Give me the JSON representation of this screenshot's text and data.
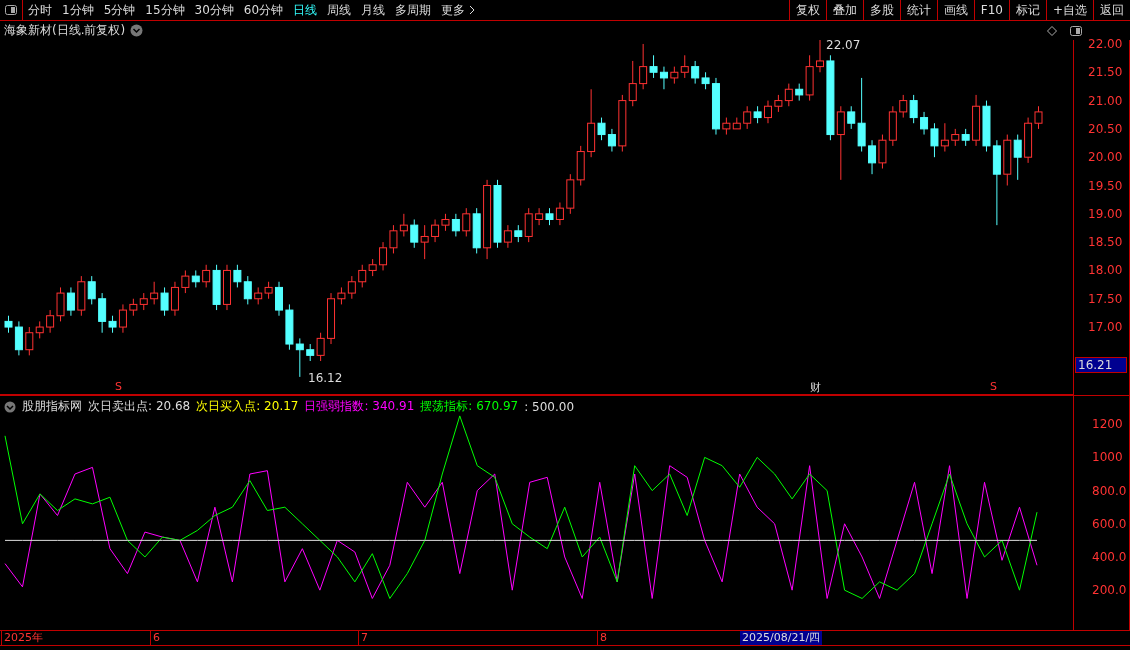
{
  "toolbar": {
    "periods": [
      {
        "label": "分时",
        "selected": false
      },
      {
        "label": "1分钟",
        "selected": false
      },
      {
        "label": "5分钟",
        "selected": false
      },
      {
        "label": "15分钟",
        "selected": false
      },
      {
        "label": "30分钟",
        "selected": false
      },
      {
        "label": "60分钟",
        "selected": false
      },
      {
        "label": "日线",
        "selected": true
      },
      {
        "label": "周线",
        "selected": false
      },
      {
        "label": "月线",
        "selected": false
      },
      {
        "label": "多周期",
        "selected": false
      }
    ],
    "more": "更多",
    "actions": [
      "复权",
      "叠加",
      "多股",
      "统计",
      "画线",
      "F10",
      "标记",
      "+自选",
      "返回"
    ]
  },
  "title": "海象新材(日线.前复权)",
  "price_chart": {
    "high_label": "22.07",
    "low_label": "16.12",
    "current_price": "16.21",
    "markers": [
      {
        "kind": "signal",
        "label": "S"
      },
      {
        "kind": "finance",
        "label": "财"
      },
      {
        "kind": "signal",
        "label": "S"
      }
    ],
    "chart_data": {
      "type": "candlestick",
      "ylim": [
        15.8,
        22.07
      ],
      "yticks": [
        {
          "value": 22,
          "label": "22.00"
        },
        {
          "value": 21.5,
          "label": "21.50"
        },
        {
          "value": 21,
          "label": "21.00"
        },
        {
          "value": 20.5,
          "label": "20.50"
        },
        {
          "value": 20,
          "label": "20.00"
        },
        {
          "value": 19.5,
          "label": "19.50"
        },
        {
          "value": 19,
          "label": "19.00"
        },
        {
          "value": 18.5,
          "label": "18.50"
        },
        {
          "value": 18,
          "label": "18.00"
        },
        {
          "value": 17.5,
          "label": "17.50"
        },
        {
          "value": 17,
          "label": "17.00"
        }
      ],
      "ohlc": [
        [
          17.1,
          17.2,
          16.9,
          17.0
        ],
        [
          17.0,
          17.1,
          16.5,
          16.6
        ],
        [
          16.6,
          17.0,
          16.5,
          16.9
        ],
        [
          16.9,
          17.1,
          16.8,
          17.0
        ],
        [
          17.0,
          17.3,
          16.9,
          17.2
        ],
        [
          17.2,
          17.7,
          17.1,
          17.6
        ],
        [
          17.6,
          17.7,
          17.2,
          17.3
        ],
        [
          17.3,
          17.9,
          17.2,
          17.8
        ],
        [
          17.8,
          17.9,
          17.4,
          17.5
        ],
        [
          17.5,
          17.6,
          16.9,
          17.1
        ],
        [
          17.1,
          17.2,
          16.9,
          17.0
        ],
        [
          17.0,
          17.4,
          16.9,
          17.3
        ],
        [
          17.3,
          17.5,
          17.2,
          17.4
        ],
        [
          17.4,
          17.6,
          17.3,
          17.5
        ],
        [
          17.5,
          17.8,
          17.4,
          17.6
        ],
        [
          17.6,
          17.7,
          17.2,
          17.3
        ],
        [
          17.3,
          17.8,
          17.2,
          17.7
        ],
        [
          17.7,
          18.0,
          17.6,
          17.9
        ],
        [
          17.9,
          18.0,
          17.7,
          17.8
        ],
        [
          17.8,
          18.1,
          17.7,
          18.0
        ],
        [
          18.0,
          18.1,
          17.3,
          17.4
        ],
        [
          17.4,
          18.1,
          17.3,
          18.0
        ],
        [
          18.0,
          18.1,
          17.7,
          17.8
        ],
        [
          17.8,
          17.9,
          17.4,
          17.5
        ],
        [
          17.5,
          17.7,
          17.4,
          17.6
        ],
        [
          17.6,
          17.8,
          17.5,
          17.7
        ],
        [
          17.7,
          17.8,
          17.2,
          17.3
        ],
        [
          17.3,
          17.4,
          16.6,
          16.7
        ],
        [
          16.7,
          16.8,
          16.12,
          16.6
        ],
        [
          16.6,
          16.7,
          16.4,
          16.5
        ],
        [
          16.5,
          16.9,
          16.4,
          16.8
        ],
        [
          16.8,
          17.6,
          16.7,
          17.5
        ],
        [
          17.5,
          17.7,
          17.4,
          17.6
        ],
        [
          17.6,
          17.9,
          17.5,
          17.8
        ],
        [
          17.8,
          18.1,
          17.7,
          18.0
        ],
        [
          18.0,
          18.2,
          17.9,
          18.1
        ],
        [
          18.1,
          18.5,
          18.0,
          18.4
        ],
        [
          18.4,
          18.8,
          18.3,
          18.7
        ],
        [
          18.7,
          19.0,
          18.6,
          18.8
        ],
        [
          18.8,
          18.9,
          18.4,
          18.5
        ],
        [
          18.5,
          18.8,
          18.2,
          18.6
        ],
        [
          18.6,
          18.9,
          18.5,
          18.8
        ],
        [
          18.8,
          19.0,
          18.7,
          18.9
        ],
        [
          18.9,
          19.0,
          18.6,
          18.7
        ],
        [
          18.7,
          19.1,
          18.6,
          19.0
        ],
        [
          19.0,
          19.1,
          18.3,
          18.4
        ],
        [
          18.4,
          19.6,
          18.2,
          19.5
        ],
        [
          19.5,
          19.6,
          18.4,
          18.5
        ],
        [
          18.5,
          18.8,
          18.4,
          18.7
        ],
        [
          18.7,
          18.8,
          18.5,
          18.6
        ],
        [
          18.6,
          19.1,
          18.5,
          19.0
        ],
        [
          18.9,
          19.1,
          18.8,
          19.0
        ],
        [
          19.0,
          19.1,
          18.8,
          18.9
        ],
        [
          18.9,
          19.2,
          18.8,
          19.1
        ],
        [
          19.1,
          19.7,
          19.0,
          19.6
        ],
        [
          19.6,
          20.2,
          19.5,
          20.1
        ],
        [
          20.1,
          21.2,
          20.0,
          20.6
        ],
        [
          20.6,
          20.7,
          20.3,
          20.4
        ],
        [
          20.4,
          20.5,
          20.1,
          20.2
        ],
        [
          20.2,
          21.1,
          20.1,
          21.0
        ],
        [
          21.0,
          21.7,
          20.9,
          21.3
        ],
        [
          21.3,
          22.0,
          21.2,
          21.6
        ],
        [
          21.6,
          21.8,
          21.4,
          21.5
        ],
        [
          21.5,
          21.6,
          21.2,
          21.4
        ],
        [
          21.4,
          21.6,
          21.3,
          21.5
        ],
        [
          21.5,
          21.8,
          21.4,
          21.6
        ],
        [
          21.6,
          21.7,
          21.3,
          21.4
        ],
        [
          21.4,
          21.5,
          21.2,
          21.3
        ],
        [
          21.3,
          21.4,
          20.4,
          20.5
        ],
        [
          20.5,
          20.7,
          20.4,
          20.6
        ],
        [
          20.5,
          20.7,
          20.5,
          20.6
        ],
        [
          20.6,
          20.9,
          20.5,
          20.8
        ],
        [
          20.8,
          20.9,
          20.6,
          20.7
        ],
        [
          20.7,
          21.0,
          20.6,
          20.9
        ],
        [
          20.9,
          21.1,
          20.8,
          21.0
        ],
        [
          21.0,
          21.3,
          20.9,
          21.2
        ],
        [
          21.2,
          21.3,
          21.0,
          21.1
        ],
        [
          21.1,
          21.8,
          21.0,
          21.6
        ],
        [
          21.6,
          22.07,
          21.5,
          21.7
        ],
        [
          21.7,
          21.8,
          20.3,
          20.4
        ],
        [
          20.4,
          20.9,
          19.6,
          20.8
        ],
        [
          20.8,
          20.9,
          20.5,
          20.6
        ],
        [
          20.6,
          21.4,
          20.1,
          20.2
        ],
        [
          20.2,
          20.3,
          19.7,
          19.9
        ],
        [
          19.9,
          20.4,
          19.8,
          20.3
        ],
        [
          20.3,
          20.9,
          20.2,
          20.8
        ],
        [
          20.8,
          21.1,
          20.7,
          21.0
        ],
        [
          21.0,
          21.1,
          20.6,
          20.7
        ],
        [
          20.7,
          20.8,
          20.4,
          20.5
        ],
        [
          20.5,
          20.6,
          20.0,
          20.2
        ],
        [
          20.2,
          20.6,
          20.1,
          20.3
        ],
        [
          20.3,
          20.5,
          20.2,
          20.4
        ],
        [
          20.4,
          20.5,
          20.2,
          20.3
        ],
        [
          20.3,
          21.1,
          20.2,
          20.9
        ],
        [
          20.9,
          21.0,
          20.1,
          20.2
        ],
        [
          20.2,
          20.3,
          18.8,
          19.7
        ],
        [
          19.7,
          20.4,
          19.5,
          20.3
        ],
        [
          20.3,
          20.4,
          19.6,
          20.0
        ],
        [
          20.0,
          20.7,
          19.9,
          20.6
        ],
        [
          20.6,
          20.9,
          20.5,
          20.8
        ]
      ]
    }
  },
  "indicator": {
    "name": "股朋指标网",
    "legend": [
      {
        "label": "次日卖出点:",
        "value": "20.68",
        "color": "#dddddd"
      },
      {
        "label": "次日买入点:",
        "value": "20.17",
        "color": "#ffff00"
      },
      {
        "label": "日强弱指数:",
        "value": "340.91",
        "color": "#ff00ff"
      },
      {
        "label": "摆荡指标:",
        "value": "670.97",
        "color": "#00ff00"
      },
      {
        "label": ":",
        "value": "500.00",
        "color": "#dddddd"
      }
    ],
    "chart_data": {
      "type": "line",
      "ylim": [
        -40,
        1370
      ],
      "yticks": [
        {
          "value": 1200,
          "label": "1200"
        },
        {
          "value": 1000,
          "label": "1000"
        },
        {
          "value": 800,
          "label": "800.0"
        },
        {
          "value": 600,
          "label": "600.0"
        },
        {
          "value": 400,
          "label": "400.0"
        },
        {
          "value": 200,
          "label": "200.0"
        }
      ],
      "series": [
        {
          "color": "#ff00ff",
          "values": [
            360,
            220,
            780,
            650,
            900,
            940,
            450,
            300,
            550,
            520,
            500,
            250,
            700,
            250,
            900,
            920,
            250,
            450,
            200,
            500,
            430,
            150,
            350,
            850,
            700,
            850,
            300,
            800,
            900,
            200,
            850,
            880,
            400,
            150,
            850,
            250,
            900,
            150,
            950,
            880,
            500,
            250,
            900,
            700,
            600,
            200,
            950,
            150,
            600,
            400,
            150,
            500,
            850,
            300,
            950,
            150,
            850,
            380,
            700,
            350
          ]
        },
        {
          "color": "#00ff00",
          "values": [
            1130,
            600,
            780,
            680,
            750,
            720,
            760,
            500,
            400,
            520,
            500,
            560,
            650,
            700,
            860,
            680,
            700,
            600,
            500,
            400,
            250,
            420,
            150,
            300,
            500,
            900,
            1250,
            950,
            880,
            600,
            520,
            450,
            700,
            400,
            520,
            250,
            950,
            800,
            900,
            650,
            1000,
            950,
            820,
            1000,
            900,
            750,
            900,
            800,
            200,
            150,
            250,
            200,
            300,
            600,
            900,
            600,
            400,
            500,
            200,
            670
          ]
        },
        {
          "color": "#dddddd",
          "values": [
            500,
            500,
            500,
            500,
            500,
            500,
            500,
            500,
            500,
            500,
            500,
            500,
            500,
            500,
            500,
            500,
            500,
            500,
            500,
            500,
            500,
            500,
            500,
            500,
            500,
            500,
            500,
            500,
            500,
            500,
            500,
            500,
            500,
            500,
            500,
            500,
            500,
            500,
            500,
            500,
            500,
            500,
            500,
            500,
            500,
            500,
            500,
            500,
            500,
            500,
            500,
            500,
            500,
            500,
            500,
            500,
            500,
            500,
            500,
            500
          ]
        }
      ]
    }
  },
  "date_axis": {
    "labels": [
      "2025年",
      "6",
      "7",
      "8"
    ],
    "cursor_date": "2025/08/21/四"
  }
}
